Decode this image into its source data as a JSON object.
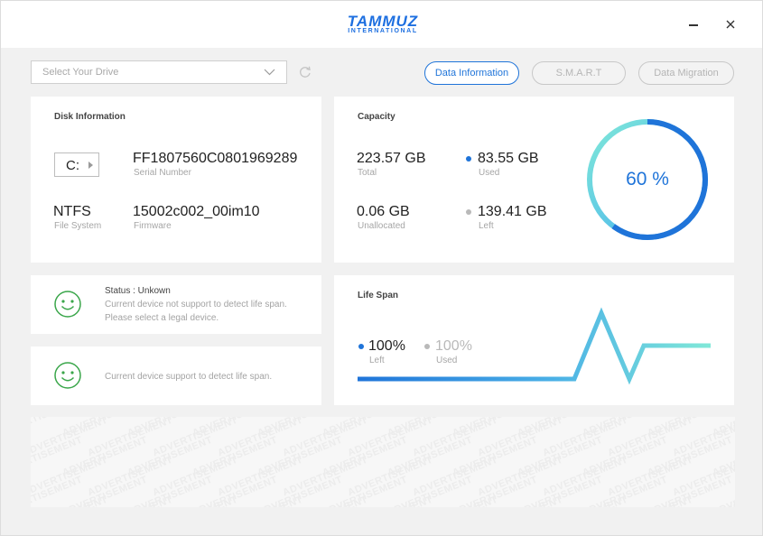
{
  "header": {
    "logo_main": "TAMMUZ",
    "logo_sub": "INTERNATIONAL"
  },
  "toolbar": {
    "drive_select_placeholder": "Select Your Drive",
    "tabs": [
      {
        "label": "Data Information",
        "active": true
      },
      {
        "label": "S.M.A.R.T",
        "active": false
      },
      {
        "label": "Data Migration",
        "active": false
      }
    ]
  },
  "disk_info": {
    "title": "Disk Information",
    "drive_letter": "C:",
    "serial_number": "FF1807560C0801969289",
    "serial_label": "Serial Number",
    "file_system": "NTFS",
    "file_system_label": "File System",
    "firmware": "15002c002_00im10",
    "firmware_label": "Firmware"
  },
  "capacity": {
    "title": "Capacity",
    "total": "223.57 GB",
    "total_label": "Total",
    "used": "83.55 GB",
    "used_label": "Used",
    "unallocated": "0.06 GB",
    "unallocated_label": "Unallocated",
    "left": "139.41 GB",
    "left_label": "Left",
    "percent_text": "60 %",
    "percent_value": 0.6
  },
  "status_unknown": {
    "title": "Status : Unkown",
    "line1": "Current device not support to detect life span.",
    "line2": "Please select a legal device."
  },
  "status_supported": {
    "text": "Current device support to detect life span."
  },
  "life_span": {
    "title": "Life Span",
    "left_value": "100%",
    "left_label": "Left",
    "used_value": "100%",
    "used_label": "Used"
  },
  "advertisement": {
    "word": "ADVERTISEMENT"
  },
  "colors": {
    "accent": "#1f74d9",
    "teal": "#7fe5d8",
    "smile_green": "#3aa64a",
    "background": "#f1f1f1"
  }
}
